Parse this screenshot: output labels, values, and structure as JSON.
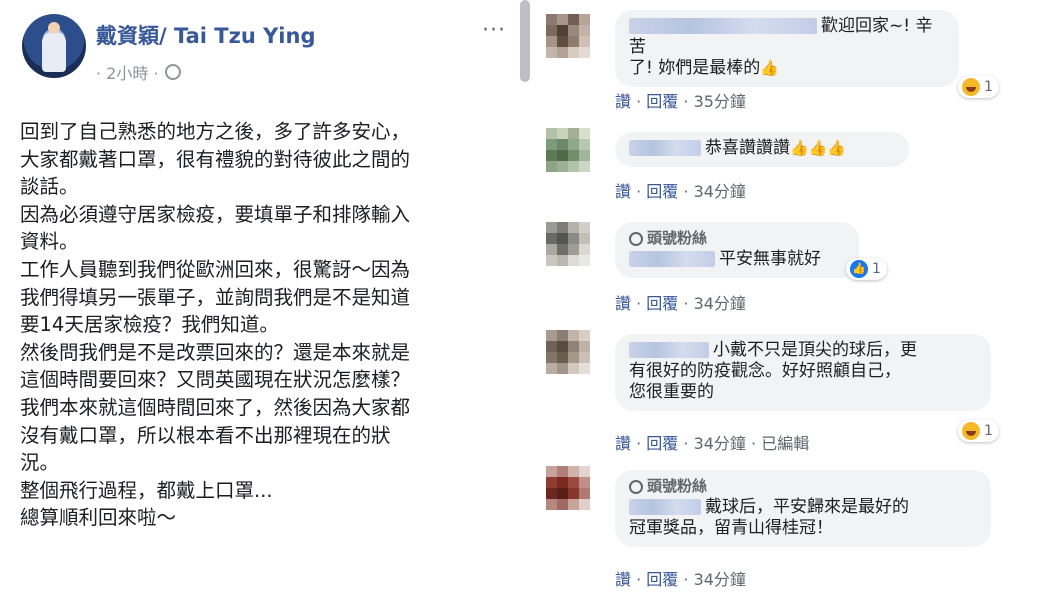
{
  "post": {
    "author": "戴資穎/ Tai Tzu Ying",
    "time": "· 2小時 ·",
    "more_icon": "ellipsis-icon",
    "lines": [
      "回到了自己熟悉的地方之後，多了許多安心，",
      "大家都戴著口罩，很有禮貌的對待彼此之間的",
      "談話。",
      "因為必須遵守居家檢疫，要填單子和排隊輸入",
      "資料。",
      "工作人員聽到我們從歐洲回來，很驚訝～因為",
      "我們得填另一張單子，並詢問我們是不是知道",
      "要14天居家檢疫？我們知道。",
      "然後問我們是不是改票回來的？還是本來就是",
      "這個時間要回來？又問英國現在狀況怎麼樣？",
      "我們本來就這個時間回來了，然後因為大家都",
      "沒有戴口罩，所以根本看不出那裡現在的狀",
      "況。",
      "整個飛行過程，都戴上口罩...",
      "總算順利回來啦～"
    ]
  },
  "comments": [
    {
      "badge": "",
      "text_lines": [
        "歡迎回家~! 辛苦",
        "了! 妳們是最棒的"
      ],
      "emoji": "👍",
      "like": "讚",
      "reply": "回覆",
      "time": "35分鐘",
      "edited": "",
      "reaction_type": "haha",
      "reaction_count": "1"
    },
    {
      "badge": "",
      "text_lines": [
        "恭喜讚讚讚"
      ],
      "emoji": "👍👍👍",
      "like": "讚",
      "reply": "回覆",
      "time": "34分鐘",
      "edited": "",
      "reaction_type": "",
      "reaction_count": ""
    },
    {
      "badge": "頭號粉絲",
      "text_lines": [
        "平安無事就好"
      ],
      "emoji": "",
      "like": "讚",
      "reply": "回覆",
      "time": "34分鐘",
      "edited": "",
      "reaction_type": "like",
      "reaction_count": "1"
    },
    {
      "badge": "",
      "text_lines": [
        "小戴不只是頂尖的球后，更",
        "有很好的防疫觀念。好好照顧自己，",
        "您很重要的"
      ],
      "emoji": "",
      "like": "讚",
      "reply": "回覆",
      "time": "34分鐘",
      "edited": "已編輯",
      "reaction_type": "haha",
      "reaction_count": "1"
    },
    {
      "badge": "頭號粉絲",
      "text_lines": [
        "戴球后，平安歸來是最好的",
        "冠軍獎品，留青山得桂冠！"
      ],
      "emoji": "",
      "like": "讚",
      "reply": "回覆",
      "time": "34分鐘",
      "edited": "",
      "reaction_type": "",
      "reaction_count": ""
    }
  ]
}
